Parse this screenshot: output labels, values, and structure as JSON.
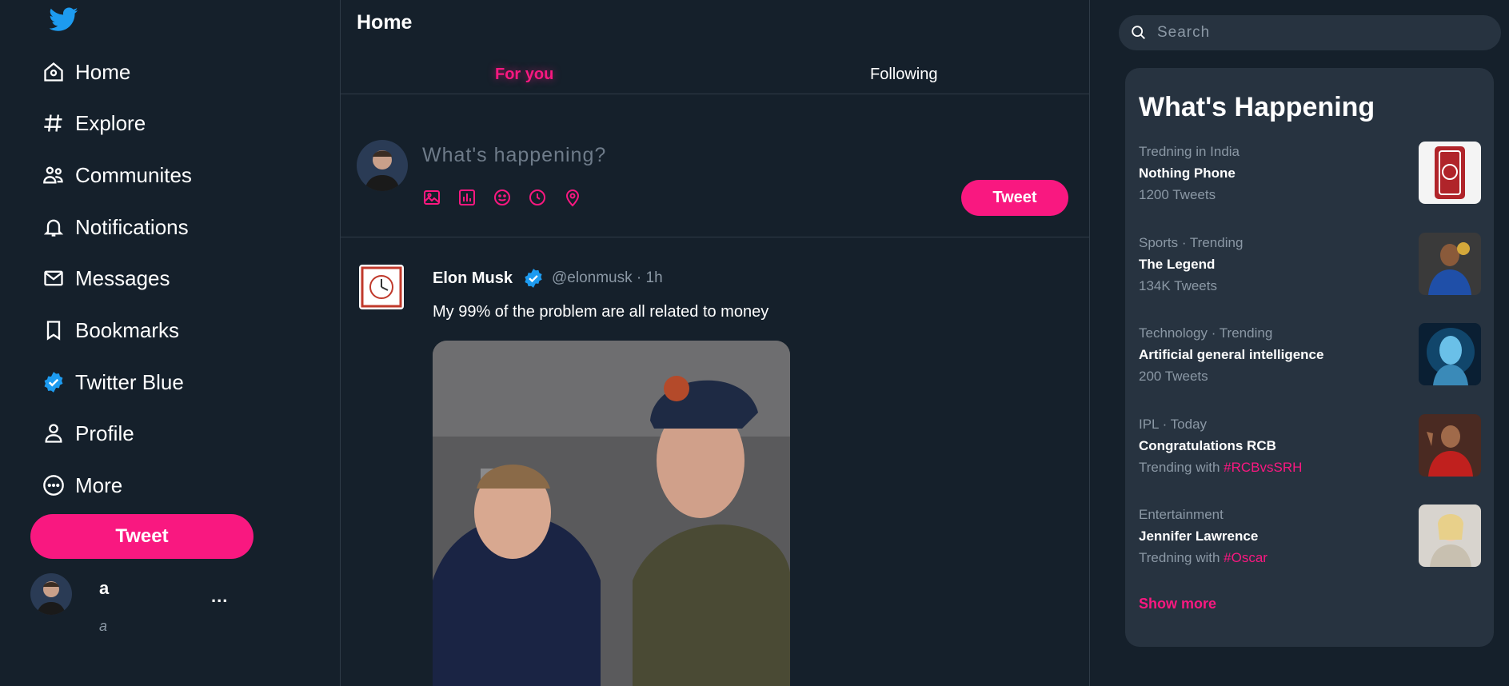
{
  "nav": {
    "items": [
      {
        "label": "Home",
        "icon": "home-icon"
      },
      {
        "label": "Explore",
        "icon": "hashtag-icon"
      },
      {
        "label": "Communites",
        "icon": "communities-icon"
      },
      {
        "label": "Notifications",
        "icon": "bell-icon"
      },
      {
        "label": "Messages",
        "icon": "envelope-icon"
      },
      {
        "label": "Bookmarks",
        "icon": "bookmark-icon"
      },
      {
        "label": "Twitter Blue",
        "icon": "verified-badge-icon"
      },
      {
        "label": "Profile",
        "icon": "person-icon"
      },
      {
        "label": "More",
        "icon": "more-circle-icon"
      }
    ],
    "tweet_button": "Tweet"
  },
  "user": {
    "name": "a",
    "handle": "a",
    "more": "..."
  },
  "main": {
    "title": "Home",
    "tabs": [
      {
        "label": "For you",
        "active": true
      },
      {
        "label": "Following",
        "active": false
      }
    ],
    "compose": {
      "placeholder": "What's happening?",
      "tweet_button": "Tweet",
      "icons": [
        "image-icon",
        "poll-icon",
        "emoji-icon",
        "schedule-icon",
        "location-icon"
      ]
    },
    "post": {
      "name": "Elon Musk",
      "handle": "@elonmusk",
      "time": "· 1h",
      "text": "My 99% of the problem are all related to money"
    }
  },
  "search": {
    "placeholder": "Search"
  },
  "trends": {
    "title": "What's Happening",
    "items": [
      {
        "category": "Tredning in India",
        "title": "Nothing Phone",
        "count": "1200 Tweets",
        "tag": ""
      },
      {
        "category": "Sports · Trending",
        "title": "The Legend",
        "count": "134K Tweets",
        "tag": ""
      },
      {
        "category": "Technology · Trending",
        "title": "Artificial general intelligence",
        "count": "200 Tweets",
        "tag": ""
      },
      {
        "category": "IPL · Today",
        "title": "Congratulations RCB",
        "count": "Trending with ",
        "tag": "#RCBvsSRH"
      },
      {
        "category": "Entertainment",
        "title": "Jennifer Lawrence",
        "count": "Tredning with ",
        "tag": "#Oscar"
      }
    ],
    "show_more": "Show more"
  },
  "colors": {
    "background": "#15202b",
    "accent": "#f91880",
    "panel": "#273340",
    "muted": "#8b98a5",
    "verified": "#1d9bf0"
  }
}
